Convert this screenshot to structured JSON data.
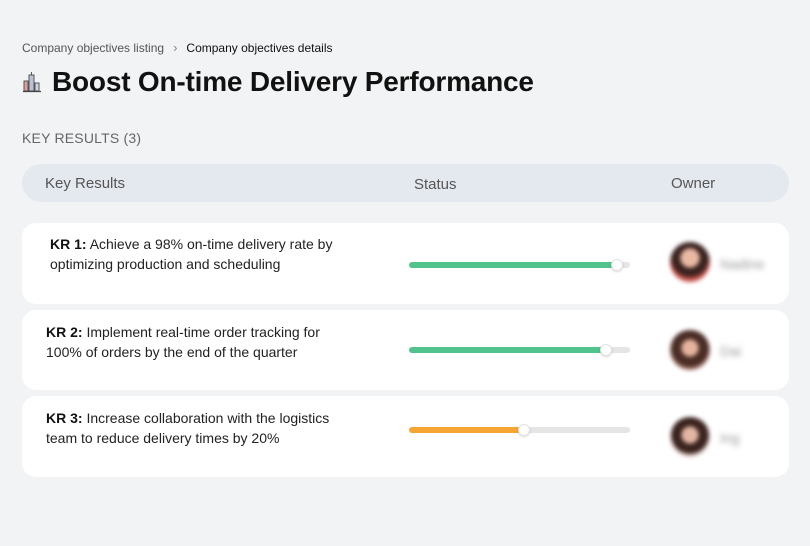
{
  "breadcrumb": {
    "parent": "Company objectives listing",
    "separator": "›",
    "current": "Company objectives details"
  },
  "page": {
    "title": "Boost On-time Delivery Performance",
    "title_icon": "building-chart-icon"
  },
  "section": {
    "label": "KEY RESULTS (3)"
  },
  "table": {
    "headers": {
      "key_results": "Key Results",
      "status": "Status",
      "owner": "Owner"
    }
  },
  "colors": {
    "progress_green": "#52c38c",
    "progress_orange": "#f6a532",
    "track": "#e5e5e5"
  },
  "key_results": [
    {
      "label": "KR 1:",
      "text": "Achieve a 98% on-time delivery rate by optimizing production and scheduling",
      "progress": 0.94,
      "status_color": "green",
      "owner": "Nadine"
    },
    {
      "label": "KR 2:",
      "text": "Implement real-time order tracking for 100% of orders by the end of the quarter",
      "progress": 0.89,
      "status_color": "green",
      "owner": "Dai"
    },
    {
      "label": "KR 3:",
      "text": "Increase collaboration with the logistics team to reduce delivery times by 20%",
      "progress": 0.52,
      "status_color": "orange",
      "owner": "Ing"
    }
  ]
}
